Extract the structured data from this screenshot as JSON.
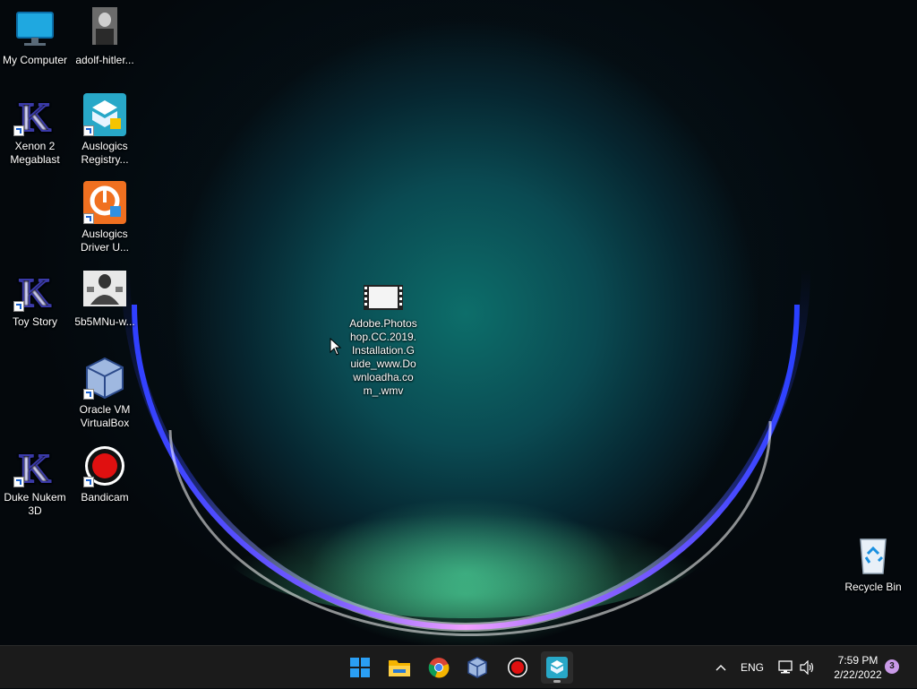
{
  "desktop_icons": [
    {
      "label": "My Computer"
    },
    {
      "label": "adolf-hitler..."
    },
    {
      "label": "Xenon 2 Megablast"
    },
    {
      "label": "Auslogics Registry..."
    },
    {
      "label": "Auslogics Driver U..."
    },
    {
      "label": "Toy Story"
    },
    {
      "label": "5b5MNu-w..."
    },
    {
      "label": "Oracle VM VirtualBox"
    },
    {
      "label": "Duke Nukem 3D"
    },
    {
      "label": "Bandicam"
    },
    {
      "label": "Adobe.Photoshop.CC.2019.Installation.Guide_www.Downloadha.com_.wmv"
    },
    {
      "label": "Recycle Bin"
    }
  ],
  "taskbar": {
    "apps": [
      {
        "name": "start-button"
      },
      {
        "name": "file-explorer"
      },
      {
        "name": "chrome"
      },
      {
        "name": "virtualbox"
      },
      {
        "name": "bandicam"
      },
      {
        "name": "auslogics-registry"
      }
    ],
    "tray": {
      "language": "ENG",
      "time": "7:59 PM",
      "date": "2/22/2022",
      "notification_count": "3"
    }
  },
  "colors": {
    "taskbar_bg": "#1b1b1b",
    "accent": "#0078d4"
  }
}
